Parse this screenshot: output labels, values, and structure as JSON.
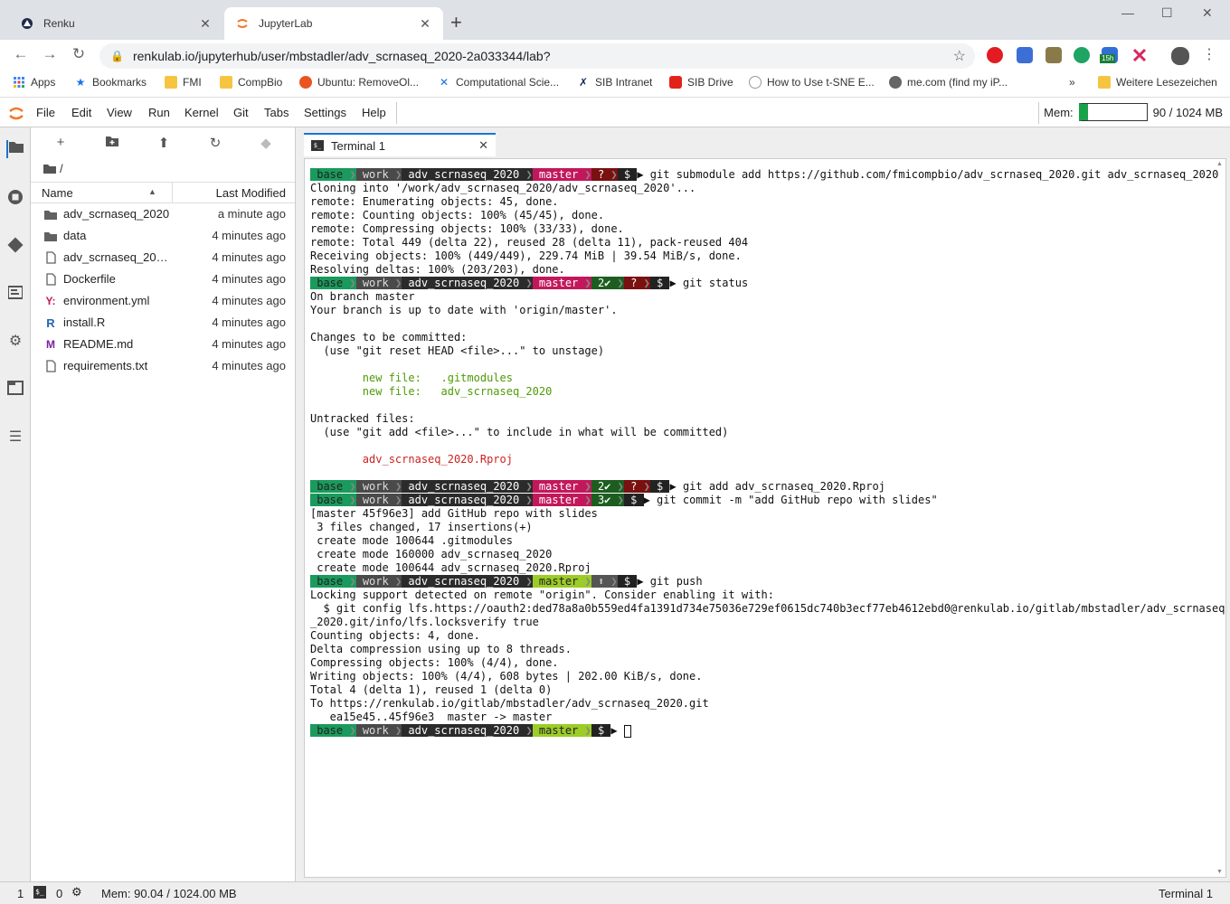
{
  "browser": {
    "tabs": [
      {
        "title": "Renku",
        "close": "✕"
      },
      {
        "title": "JupyterLab",
        "close": "✕"
      }
    ],
    "new_tab": "+",
    "window": {
      "minimize": "—",
      "maximize": "☐",
      "close": "✕"
    },
    "nav": {
      "back": "←",
      "forward": "→",
      "reload": "↻"
    },
    "url": "renkulab.io/jupyterhub/user/mbstadler/adv_scrnaseq_2020-2a033344/lab?",
    "lock": "🔒",
    "star": "☆",
    "ext_badge": "15h",
    "menu": "⋮",
    "bookmarks": [
      {
        "label": "Apps",
        "icon": "apps-icon"
      },
      {
        "label": "Bookmarks",
        "icon": "star-icon"
      },
      {
        "label": "FMI",
        "icon": "folder-icon"
      },
      {
        "label": "CompBio",
        "icon": "folder-icon"
      },
      {
        "label": "Ubuntu: RemoveOl...",
        "icon": "ubuntu-icon"
      },
      {
        "label": "Computational Scie...",
        "icon": "confluence-icon"
      },
      {
        "label": "SIB Intranet",
        "icon": "sib-icon"
      },
      {
        "label": "SIB Drive",
        "icon": "drive-icon"
      },
      {
        "label": "How to Use t-SNE E...",
        "icon": "distill-icon"
      },
      {
        "label": "me.com (find my iP...",
        "icon": "apple-icon"
      }
    ],
    "more": "»",
    "other_bookmarks": "Weitere Lesezeichen"
  },
  "jupyter": {
    "menus": [
      "File",
      "Edit",
      "View",
      "Run",
      "Kernel",
      "Git",
      "Tabs",
      "Settings",
      "Help"
    ],
    "mem_label": "Mem:",
    "mem_value": "90 / 1024 MB",
    "mem_fraction": 0.088,
    "file_toolbar": {
      "new": "+",
      "new_folder": "▪",
      "upload": "⬆",
      "refresh": "↻",
      "git": "◆"
    },
    "breadcrumb": "/",
    "columns": {
      "name": "Name",
      "modified": "Last Modified"
    },
    "files": [
      {
        "name": "adv_scrnaseq_2020",
        "modified": "a minute ago",
        "icon": "folder"
      },
      {
        "name": "data",
        "modified": "4 minutes ago",
        "icon": "folder"
      },
      {
        "name": "adv_scrnaseq_2020.Rproj",
        "modified": "4 minutes ago",
        "icon": "file"
      },
      {
        "name": "Dockerfile",
        "modified": "4 minutes ago",
        "icon": "file"
      },
      {
        "name": "environment.yml",
        "modified": "4 minutes ago",
        "icon": "yaml"
      },
      {
        "name": "install.R",
        "modified": "4 minutes ago",
        "icon": "r"
      },
      {
        "name": "README.md",
        "modified": "4 minutes ago",
        "icon": "markdown"
      },
      {
        "name": "requirements.txt",
        "modified": "4 minutes ago",
        "icon": "file"
      }
    ],
    "terminal_tab": "Terminal 1",
    "status": {
      "one": "1",
      "zero": "0",
      "mem": "Mem: 90.04 / 1024.00 MB",
      "right": "Terminal 1"
    }
  },
  "prompt": {
    "base": " base ",
    "work": " work ",
    "sep": "❯",
    "dir": " adv_scrnaseq_2020 ",
    "branch": " master ",
    "q": " ? ",
    "ok2": " 2✔ ",
    "ok3": " 3✔ ",
    "up": " ⬆ ",
    "dollar": " $ ",
    "arrow": "▶"
  },
  "terminal_lines": [
    {
      "k": "prompt",
      "segs": [
        "base",
        "work",
        "dir",
        "branch",
        "q",
        "dollar"
      ],
      "cmd": " git submodule add https://github.com/fmicompbio/adv_scrnaseq_2020.git adv_scrnaseq_2020"
    },
    {
      "k": "text",
      "t": "Cloning into '/work/adv_scrnaseq_2020/adv_scrnaseq_2020'..."
    },
    {
      "k": "text",
      "t": "remote: Enumerating objects: 45, done."
    },
    {
      "k": "text",
      "t": "remote: Counting objects: 100% (45/45), done."
    },
    {
      "k": "text",
      "t": "remote: Compressing objects: 100% (33/33), done."
    },
    {
      "k": "text",
      "t": "remote: Total 449 (delta 22), reused 28 (delta 11), pack-reused 404"
    },
    {
      "k": "text",
      "t": "Receiving objects: 100% (449/449), 229.74 MiB | 39.54 MiB/s, done."
    },
    {
      "k": "text",
      "t": "Resolving deltas: 100% (203/203), done."
    },
    {
      "k": "prompt",
      "segs": [
        "base",
        "work",
        "dir",
        "branch",
        "ok2",
        "q",
        "dollar"
      ],
      "cmd": " git status"
    },
    {
      "k": "text",
      "t": "On branch master"
    },
    {
      "k": "text",
      "t": "Your branch is up to date with 'origin/master'."
    },
    {
      "k": "text",
      "t": ""
    },
    {
      "k": "text",
      "t": "Changes to be committed:"
    },
    {
      "k": "text",
      "t": "  (use \"git reset HEAD <file>...\" to unstage)"
    },
    {
      "k": "text",
      "t": ""
    },
    {
      "k": "green",
      "t": "        new file:   .gitmodules"
    },
    {
      "k": "green",
      "t": "        new file:   adv_scrnaseq_2020"
    },
    {
      "k": "text",
      "t": ""
    },
    {
      "k": "text",
      "t": "Untracked files:"
    },
    {
      "k": "text",
      "t": "  (use \"git add <file>...\" to include in what will be committed)"
    },
    {
      "k": "text",
      "t": ""
    },
    {
      "k": "red",
      "t": "        adv_scrnaseq_2020.Rproj"
    },
    {
      "k": "text",
      "t": ""
    },
    {
      "k": "prompt",
      "segs": [
        "base",
        "work",
        "dir",
        "branch",
        "ok2",
        "q",
        "dollar"
      ],
      "cmd": " git add adv_scrnaseq_2020.Rproj"
    },
    {
      "k": "prompt",
      "segs": [
        "base",
        "work",
        "dir",
        "branch",
        "ok3",
        "dollar"
      ],
      "cmd": " git commit -m \"add GitHub repo with slides\""
    },
    {
      "k": "text",
      "t": "[master 45f96e3] add GitHub repo with slides"
    },
    {
      "k": "text",
      "t": " 3 files changed, 17 insertions(+)"
    },
    {
      "k": "text",
      "t": " create mode 100644 .gitmodules"
    },
    {
      "k": "text",
      "t": " create mode 160000 adv_scrnaseq_2020"
    },
    {
      "k": "text",
      "t": " create mode 100644 adv_scrnaseq_2020.Rproj"
    },
    {
      "k": "prompt2",
      "segs": [
        "base",
        "work",
        "dir",
        "branch",
        "up",
        "dollar"
      ],
      "cmd": " git push"
    },
    {
      "k": "text",
      "t": "Locking support detected on remote \"origin\". Consider enabling it with:"
    },
    {
      "k": "text",
      "t": "  $ git config lfs.https://oauth2:ded78a8a0b559ed4fa1391d734e75036e729ef0615dc740b3ecf77eb4612ebd0@renkulab.io/gitlab/mbstadler/adv_scrnaseq"
    },
    {
      "k": "text",
      "t": "_2020.git/info/lfs.locksverify true"
    },
    {
      "k": "text",
      "t": "Counting objects: 4, done."
    },
    {
      "k": "text",
      "t": "Delta compression using up to 8 threads."
    },
    {
      "k": "text",
      "t": "Compressing objects: 100% (4/4), done."
    },
    {
      "k": "text",
      "t": "Writing objects: 100% (4/4), 608 bytes | 202.00 KiB/s, done."
    },
    {
      "k": "text",
      "t": "Total 4 (delta 1), reused 1 (delta 0)"
    },
    {
      "k": "text",
      "t": "To https://renkulab.io/gitlab/mbstadler/adv_scrnaseq_2020.git"
    },
    {
      "k": "text",
      "t": "   ea15e45..45f96e3  master -> master"
    },
    {
      "k": "prompt2",
      "segs": [
        "base",
        "work",
        "dir",
        "branch",
        "dollar"
      ],
      "cmd": " ",
      "cursor": true
    }
  ],
  "colors": {
    "accent": "#1976d2",
    "orange": "#f37726",
    "mem_bar": "#18a34a"
  }
}
